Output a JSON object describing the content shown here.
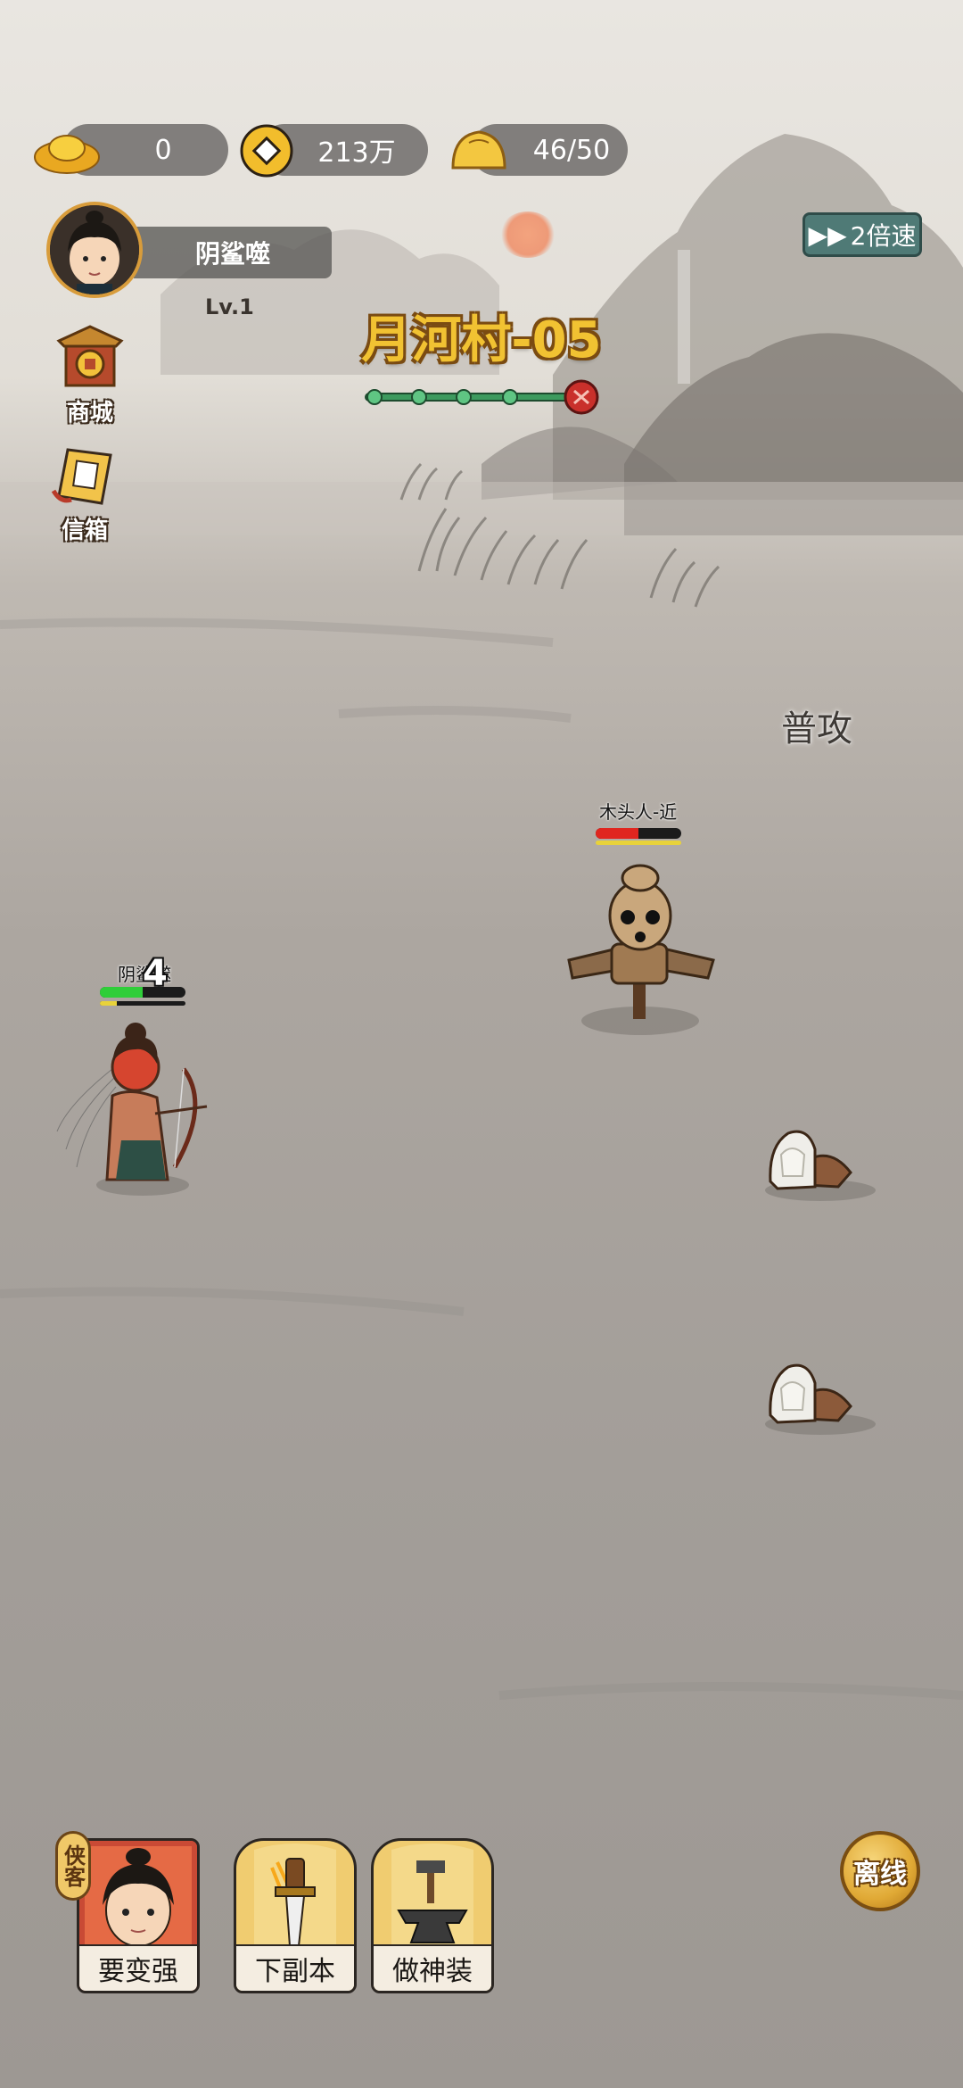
{
  "currency": {
    "gold_ingot": "0",
    "copper_coin": "213万",
    "stamina": "46/50"
  },
  "player": {
    "name": "阴鲨噬",
    "level": "Lv.1"
  },
  "side_menu": [
    {
      "label": "商城",
      "icon": "shop-gate-icon"
    },
    {
      "label": "信箱",
      "icon": "letter-scroll-icon"
    }
  ],
  "stage": {
    "title": "月河村-05",
    "progress_nodes_cleared": 4,
    "progress_nodes_total": 5
  },
  "speed_button": {
    "label": "2倍速",
    "icon": "fast-forward-icon"
  },
  "attack_label": "普攻",
  "enemy": {
    "name": "木头人-近",
    "hp_fraction": 0.5,
    "sub_fraction": 1.0
  },
  "hero_unit": {
    "name": "阴鲨噬",
    "hp_fraction": 0.5,
    "sub_fraction": 0.2,
    "damage_number": "4"
  },
  "bottom_cards": [
    {
      "label": "要变强",
      "tag": "侠客",
      "icon": "hero-portrait-icon"
    },
    {
      "label": "下副本",
      "icon": "sword-icon"
    },
    {
      "label": "做神装",
      "icon": "anvil-hammer-icon"
    }
  ],
  "offline_button": "离线",
  "colors": {
    "title_gold": "#f1c232",
    "hp_green": "#2fce39",
    "hp_red": "#e0261f",
    "energy_yellow": "#e8d23a",
    "speed_teal": "#4f7a76",
    "card_gold": "#f0cc70"
  }
}
